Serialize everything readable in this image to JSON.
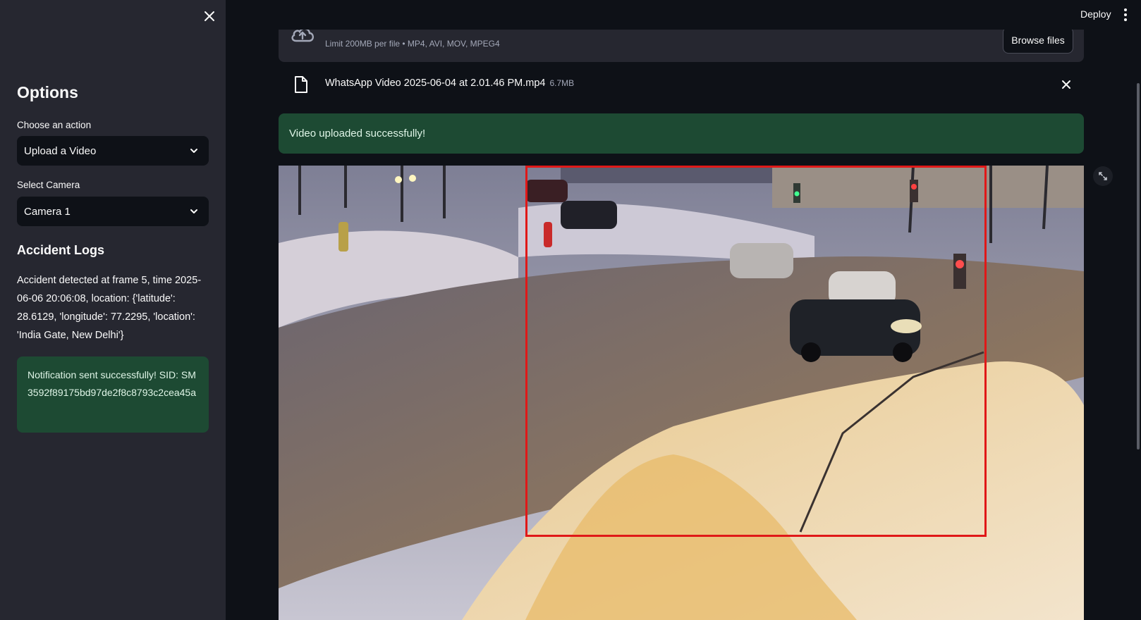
{
  "header": {
    "deploy_label": "Deploy",
    "menu_icon": "kebab-menu-icon"
  },
  "sidebar": {
    "close_icon": "close-icon",
    "title": "Options",
    "action": {
      "label": "Choose an action",
      "value": "Upload a Video"
    },
    "camera": {
      "label": "Select Camera",
      "value": "Camera 1"
    },
    "logs": {
      "title": "Accident Logs",
      "entries": [
        "Accident detected at frame 5, time 2025-06-06 20:06:08, location: {'latitude': 28.6129, 'longitude': 77.2295, 'location': 'India Gate, New Delhi'}"
      ]
    },
    "notification": "Notification sent successfully! SID: SM3592f89175bd97de2f8c8793c2cea45a"
  },
  "uploader": {
    "limit_text": "Limit 200MB per file • MP4, AVI, MOV, MPEG4",
    "browse_label": "Browse files",
    "file": {
      "name": "WhatsApp Video 2025-06-04 at 2.01.46 PM.mp4",
      "size": "6.7MB"
    }
  },
  "status": {
    "success_message": "Video uploaded successfully!"
  },
  "colors": {
    "accent_red": "#e01818",
    "success_bg": "#1d4a33",
    "sidebar_bg": "#262730",
    "main_bg": "#0e1117"
  }
}
